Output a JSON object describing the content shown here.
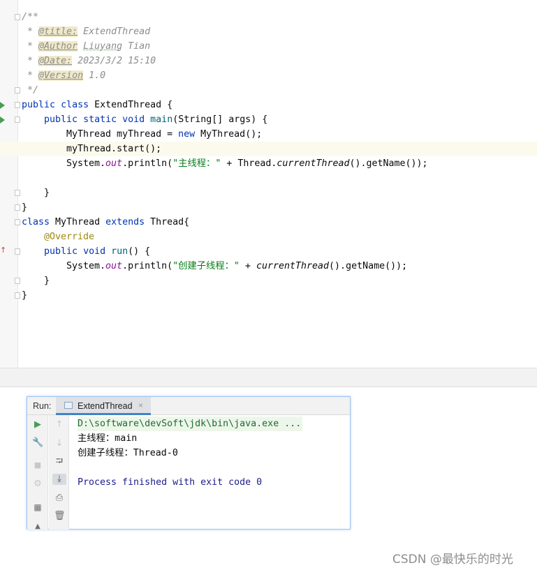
{
  "editor": {
    "javadoc": {
      "open": "/**",
      "star": " * ",
      "title_tag": "@title:",
      "title_value": " ExtendThread",
      "author_tag": "@Author",
      "author_first": "Liuyang",
      "author_rest": " Tian",
      "date_tag": "@Date:",
      "date_value": " 2023/3/2 15:10",
      "version_tag": "@Version",
      "version_value": " 1.0",
      "close": " */"
    },
    "kw_public": "public",
    "kw_class": "class",
    "kw_static": "static",
    "kw_void": "void",
    "kw_new": "new",
    "kw_extends": "extends",
    "class_decl_name": " ExtendThread {",
    "main_name": "main",
    "main_params": "(String[] args) {",
    "line_new_pre": "MyThread myThread = ",
    "line_new_post": " MyThread();",
    "line_start_pre": "myThread.",
    "line_start_call": "start",
    "line_start_post": "();",
    "sys_pre": "System.",
    "sys_out": "out",
    "println_open": ".println(",
    "str_main": "\"主线程：\"",
    "plus_thread": " + Thread.",
    "current_thread": "currentThread",
    "get_name_end": "().getName());",
    "brace_close": "}",
    "class2_decl": " MyThread ",
    "class2_super": " Thread{",
    "annotation": "@Override",
    "run_name": "run",
    "run_params": "() {",
    "str_child": "\"创建子线程：\"",
    "plus_only": " + "
  },
  "run_panel": {
    "label": "Run:",
    "tab_title": "ExtendThread",
    "tab_close": "×",
    "output": {
      "command": "D:\\software\\devSoft\\jdk\\bin\\java.exe ...",
      "line1": "主线程：main",
      "line2": "创建子线程：Thread-0",
      "finished": "Process finished with exit code 0"
    }
  },
  "toolbar_icons": [
    "rerun-icon",
    "wrench-icon",
    "stop-icon",
    "settings-gear-icon",
    "layout-icon",
    "scroll-up-icon",
    "scroll-down-icon",
    "soft-wrap-icon",
    "scroll-to-end-icon",
    "print-icon",
    "trash-icon"
  ],
  "colors": {
    "keyword": "#0033b3",
    "string": "#067d17",
    "static_field": "#871094",
    "annotation": "#9e880d",
    "method_decl": "#00627a",
    "run_green": "#499c54"
  },
  "watermark": "CSDN @最快乐的时光"
}
